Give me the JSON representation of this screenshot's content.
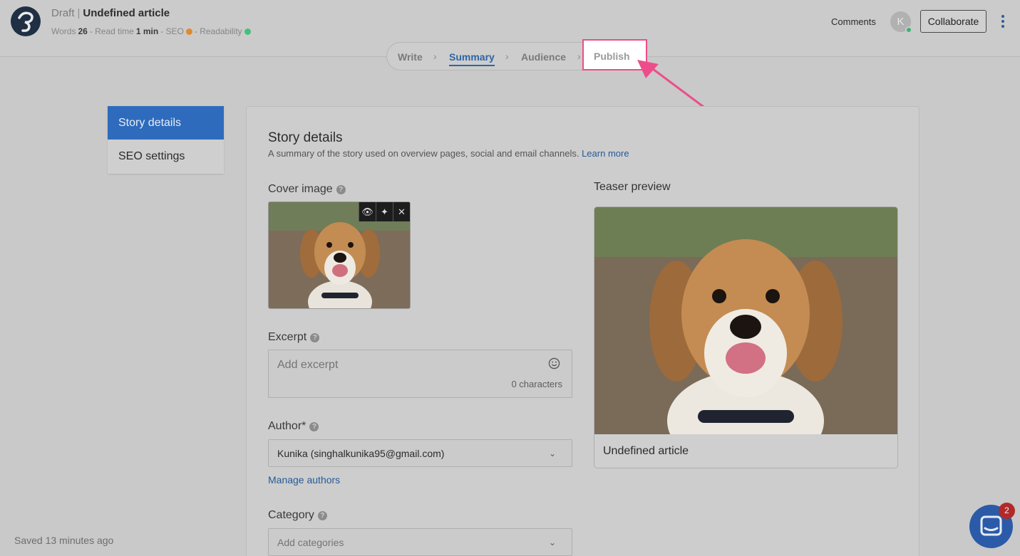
{
  "header": {
    "status": "Draft",
    "separator": "|",
    "article_title": "Undefined article",
    "words_label": "Words",
    "words_value": "26",
    "read_time_label": "- Read time",
    "read_time_value": "1 min",
    "seo_label": "- SEO",
    "readability_label": "- Readability",
    "seo_status_color": "#e08a2a",
    "readability_status_color": "#45c07a",
    "comments_label": "Comments",
    "avatar_initial": "K",
    "collaborate_label": "Collaborate"
  },
  "stepper": {
    "steps": [
      "Write",
      "Summary",
      "Audience",
      "Publish"
    ],
    "active": "Summary",
    "highlighted": "Publish",
    "highlight_color": "#ee4d8b"
  },
  "side_nav": {
    "items": [
      "Story details",
      "SEO settings"
    ],
    "active": "Story details"
  },
  "story_details": {
    "title": "Story details",
    "subtitle": "A summary of the story used on overview pages, social and email channels.",
    "learn_more": "Learn more",
    "cover_image_label": "Cover image",
    "cover_tools": [
      "view-icon",
      "magic-wand-icon",
      "close-icon"
    ],
    "excerpt_label": "Excerpt",
    "excerpt_placeholder": "Add excerpt",
    "excerpt_count": "0 characters",
    "author_label": "Author*",
    "author_value": "Kunika (singhalkunika95@gmail.com)",
    "manage_authors": "Manage authors",
    "category_label": "Category",
    "category_placeholder": "Add categories",
    "teaser_label": "Teaser preview",
    "teaser_title": "Undefined article"
  },
  "footer": {
    "saved": "Saved 13 minutes ago"
  },
  "chat": {
    "badge": "2"
  }
}
